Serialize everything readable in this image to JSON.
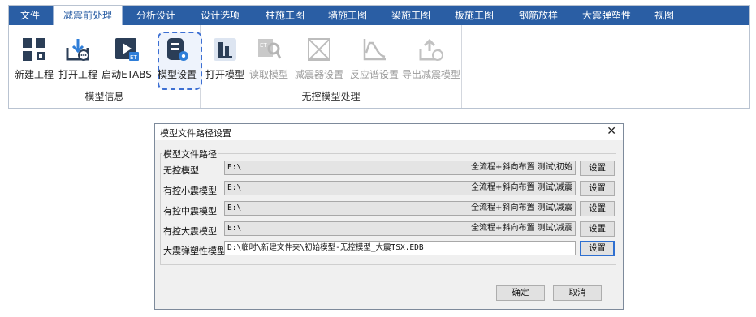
{
  "ribbon": {
    "tabs": [
      "文件",
      "减震前处理",
      "分析设计",
      "设计选项",
      "柱施工图",
      "墙施工图",
      "梁施工图",
      "板施工图",
      "钢筋放样",
      "大震弹塑性",
      "视图"
    ],
    "active_tab": "减震前处理",
    "groups": [
      {
        "label": "模型信息",
        "buttons": [
          {
            "label": "新建工程",
            "icon": "grid-new-project-icon"
          },
          {
            "label": "打开工程",
            "icon": "open-project-icon"
          },
          {
            "label": "启动ETABS",
            "icon": "launch-etabs-icon"
          },
          {
            "label": "模型设置",
            "icon": "model-settings-icon"
          }
        ]
      },
      {
        "label": "无控模型处理",
        "buttons": [
          {
            "label": "打开模型",
            "icon": "open-model-icon",
            "enabled": true
          },
          {
            "label": "读取模型",
            "icon": "read-model-icon",
            "enabled": false
          },
          {
            "label": "减震器设置",
            "icon": "damper-settings-icon",
            "enabled": false
          },
          {
            "label": "反应谱设置",
            "icon": "response-spectrum-icon",
            "enabled": false
          },
          {
            "label": "导出减震模型",
            "icon": "export-model-icon",
            "enabled": false
          }
        ]
      }
    ],
    "colors": {
      "tabbar": "#2a5ea4",
      "icon_dark": "#2b3e57",
      "icon_blue": "#2f7ed8",
      "disabled": "#c2c2c2"
    }
  },
  "dialog": {
    "title": "模型文件路径设置",
    "group_label": "模型文件路径",
    "rows": [
      {
        "label": "无控模型",
        "path_start": "E:\\",
        "path_end": "全流程+斜向布置 测试\\初始",
        "button": "设置"
      },
      {
        "label": "有控小震模型",
        "path_start": "E:\\",
        "path_end": "全流程+斜向布置 测试\\减震",
        "button": "设置"
      },
      {
        "label": "有控中震模型",
        "path_start": "E:\\",
        "path_end": "全流程+斜向布置 测试\\减震",
        "button": "设置"
      },
      {
        "label": "有控大震模型",
        "path_start": "E:\\",
        "path_end": "全流程+斜向布置 测试\\减震",
        "button": "设置"
      },
      {
        "label": "大震弹塑性模型",
        "path_start": "D:\\临时\\新建文件夹\\初始模型-无控模型_大震TSX.EDB",
        "path_end": "",
        "button": "设置"
      }
    ],
    "ok_label": "确定",
    "cancel_label": "取消",
    "close_glyph": "✕"
  }
}
